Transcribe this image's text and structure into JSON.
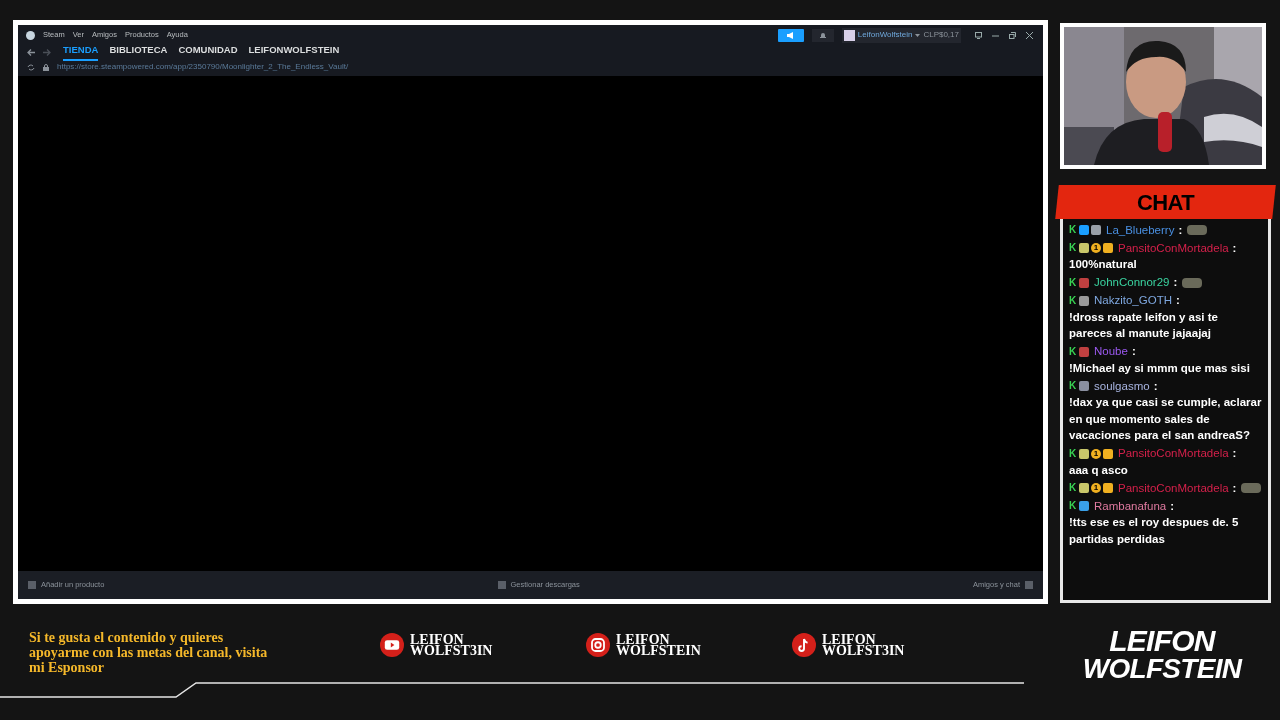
{
  "steam": {
    "menu": [
      "Steam",
      "Ver",
      "Amigos",
      "Productos",
      "Ayuda"
    ],
    "tabs": [
      {
        "label": "TIENDA",
        "selected": true
      },
      {
        "label": "BIBLIOTECA",
        "selected": false
      },
      {
        "label": "COMUNIDAD",
        "selected": false
      },
      {
        "label": "LEIFONWOLFSTEIN",
        "selected": false
      }
    ],
    "url": "https://store.steampowered.com/app/2350790/Moonlighter_2_The_Endless_Vault/",
    "username": "LeifonWolfstein",
    "wallet": "CLP$0,17",
    "footer": [
      "Añadir un producto",
      "Gestionar descargas",
      "Amigos y chat"
    ]
  },
  "chat": {
    "title": "CHAT",
    "messages": [
      {
        "user": "La_Blueberry",
        "color": "#4a90e2",
        "badges": [
          {
            "kind": "k",
            "label": "K"
          },
          {
            "kind": "tool"
          },
          {
            "kind": "gem"
          }
        ],
        "separator": ":",
        "emote": true
      },
      {
        "user": "PansitoConMortadela",
        "color": "#d4204a",
        "badges": [
          {
            "kind": "k",
            "label": "K"
          },
          {
            "kind": "bug"
          },
          {
            "kind": "one",
            "label": "1"
          },
          {
            "kind": "crown"
          }
        ],
        "separator": ":",
        "text": "100%natural",
        "emote": false
      },
      {
        "user": "JohnConnor29",
        "color": "#3ad4a0",
        "badges": [
          {
            "kind": "k",
            "label": "K"
          },
          {
            "kind": "hat"
          }
        ],
        "separator": ":",
        "emote": true
      },
      {
        "user": "Nakzito_GOTH",
        "color": "#7fa8e0",
        "badges": [
          {
            "kind": "k",
            "label": "K"
          },
          {
            "kind": "pick"
          }
        ],
        "separator": ":",
        "text": "!dross rapate leifon y asi te pareces al manute jajaajaj",
        "emote": false
      },
      {
        "user": "Noube",
        "color": "#9b59f0",
        "badges": [
          {
            "kind": "k",
            "label": "K"
          },
          {
            "kind": "hat"
          }
        ],
        "separator": ":",
        "text": "!Michael ay si mmm que mas sisi",
        "emote": false
      },
      {
        "user": "soulgasmo",
        "color": "#a8b4e0",
        "badges": [
          {
            "kind": "k",
            "label": "K"
          },
          {
            "kind": "box"
          }
        ],
        "separator": ":",
        "text": "!dax ya que casi se cumple, aclarar en que momento sales de vacaciones para el san andreaS?",
        "emote": false
      },
      {
        "user": "PansitoConMortadela",
        "color": "#d4204a",
        "badges": [
          {
            "kind": "k",
            "label": "K"
          },
          {
            "kind": "bug"
          },
          {
            "kind": "one",
            "label": "1"
          },
          {
            "kind": "crown"
          }
        ],
        "separator": ":",
        "text": "aaa q asco",
        "emote": false
      },
      {
        "user": "PansitoConMortadela",
        "color": "#d4204a",
        "badges": [
          {
            "kind": "k",
            "label": "K"
          },
          {
            "kind": "bug"
          },
          {
            "kind": "one",
            "label": "1"
          },
          {
            "kind": "crown"
          }
        ],
        "separator": ":",
        "emote": true
      },
      {
        "user": "Rambanafuna",
        "color": "#e07aa0",
        "badges": [
          {
            "kind": "k",
            "label": "K"
          },
          {
            "kind": "cube"
          }
        ],
        "separator": ":",
        "text": "!tts ese es el roy despues de. 5 partidas perdidas",
        "emote": false
      }
    ]
  },
  "sponsor": "Si te gusta el contenido y quieres apoyarme con las metas del canal, visita mi Esponsor",
  "socials": [
    {
      "kind": "youtube",
      "handle": "LEIFON WOLFST3IN"
    },
    {
      "kind": "instagram",
      "handle": "LEIFON WOLFSTEIN"
    },
    {
      "kind": "tiktok",
      "handle": "LEIFON WOLFST3IN"
    }
  ],
  "logo": [
    "LEIFON",
    "WOLFSTEIN"
  ]
}
